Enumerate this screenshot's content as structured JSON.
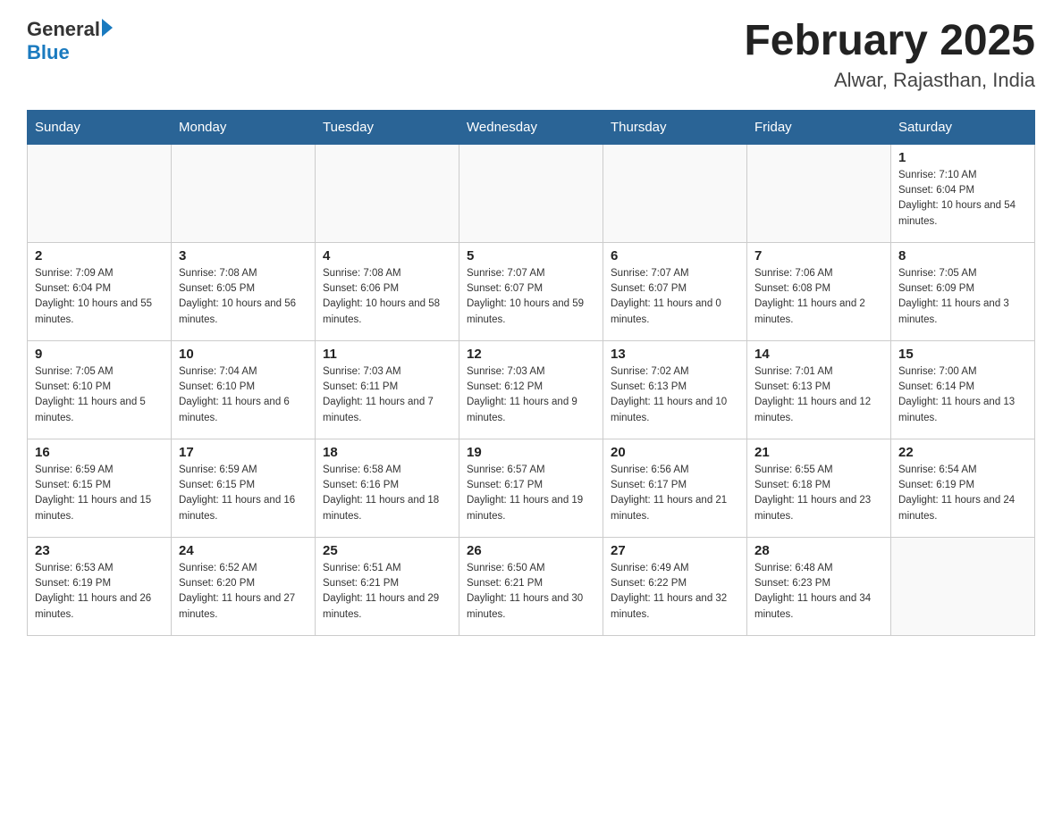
{
  "header": {
    "logo_general": "General",
    "logo_blue": "Blue",
    "month_title": "February 2025",
    "location": "Alwar, Rajasthan, India"
  },
  "weekdays": [
    "Sunday",
    "Monday",
    "Tuesday",
    "Wednesday",
    "Thursday",
    "Friday",
    "Saturday"
  ],
  "weeks": [
    [
      {
        "day": "",
        "sunrise": "",
        "sunset": "",
        "daylight": ""
      },
      {
        "day": "",
        "sunrise": "",
        "sunset": "",
        "daylight": ""
      },
      {
        "day": "",
        "sunrise": "",
        "sunset": "",
        "daylight": ""
      },
      {
        "day": "",
        "sunrise": "",
        "sunset": "",
        "daylight": ""
      },
      {
        "day": "",
        "sunrise": "",
        "sunset": "",
        "daylight": ""
      },
      {
        "day": "",
        "sunrise": "",
        "sunset": "",
        "daylight": ""
      },
      {
        "day": "1",
        "sunrise": "Sunrise: 7:10 AM",
        "sunset": "Sunset: 6:04 PM",
        "daylight": "Daylight: 10 hours and 54 minutes."
      }
    ],
    [
      {
        "day": "2",
        "sunrise": "Sunrise: 7:09 AM",
        "sunset": "Sunset: 6:04 PM",
        "daylight": "Daylight: 10 hours and 55 minutes."
      },
      {
        "day": "3",
        "sunrise": "Sunrise: 7:08 AM",
        "sunset": "Sunset: 6:05 PM",
        "daylight": "Daylight: 10 hours and 56 minutes."
      },
      {
        "day": "4",
        "sunrise": "Sunrise: 7:08 AM",
        "sunset": "Sunset: 6:06 PM",
        "daylight": "Daylight: 10 hours and 58 minutes."
      },
      {
        "day": "5",
        "sunrise": "Sunrise: 7:07 AM",
        "sunset": "Sunset: 6:07 PM",
        "daylight": "Daylight: 10 hours and 59 minutes."
      },
      {
        "day": "6",
        "sunrise": "Sunrise: 7:07 AM",
        "sunset": "Sunset: 6:07 PM",
        "daylight": "Daylight: 11 hours and 0 minutes."
      },
      {
        "day": "7",
        "sunrise": "Sunrise: 7:06 AM",
        "sunset": "Sunset: 6:08 PM",
        "daylight": "Daylight: 11 hours and 2 minutes."
      },
      {
        "day": "8",
        "sunrise": "Sunrise: 7:05 AM",
        "sunset": "Sunset: 6:09 PM",
        "daylight": "Daylight: 11 hours and 3 minutes."
      }
    ],
    [
      {
        "day": "9",
        "sunrise": "Sunrise: 7:05 AM",
        "sunset": "Sunset: 6:10 PM",
        "daylight": "Daylight: 11 hours and 5 minutes."
      },
      {
        "day": "10",
        "sunrise": "Sunrise: 7:04 AM",
        "sunset": "Sunset: 6:10 PM",
        "daylight": "Daylight: 11 hours and 6 minutes."
      },
      {
        "day": "11",
        "sunrise": "Sunrise: 7:03 AM",
        "sunset": "Sunset: 6:11 PM",
        "daylight": "Daylight: 11 hours and 7 minutes."
      },
      {
        "day": "12",
        "sunrise": "Sunrise: 7:03 AM",
        "sunset": "Sunset: 6:12 PM",
        "daylight": "Daylight: 11 hours and 9 minutes."
      },
      {
        "day": "13",
        "sunrise": "Sunrise: 7:02 AM",
        "sunset": "Sunset: 6:13 PM",
        "daylight": "Daylight: 11 hours and 10 minutes."
      },
      {
        "day": "14",
        "sunrise": "Sunrise: 7:01 AM",
        "sunset": "Sunset: 6:13 PM",
        "daylight": "Daylight: 11 hours and 12 minutes."
      },
      {
        "day": "15",
        "sunrise": "Sunrise: 7:00 AM",
        "sunset": "Sunset: 6:14 PM",
        "daylight": "Daylight: 11 hours and 13 minutes."
      }
    ],
    [
      {
        "day": "16",
        "sunrise": "Sunrise: 6:59 AM",
        "sunset": "Sunset: 6:15 PM",
        "daylight": "Daylight: 11 hours and 15 minutes."
      },
      {
        "day": "17",
        "sunrise": "Sunrise: 6:59 AM",
        "sunset": "Sunset: 6:15 PM",
        "daylight": "Daylight: 11 hours and 16 minutes."
      },
      {
        "day": "18",
        "sunrise": "Sunrise: 6:58 AM",
        "sunset": "Sunset: 6:16 PM",
        "daylight": "Daylight: 11 hours and 18 minutes."
      },
      {
        "day": "19",
        "sunrise": "Sunrise: 6:57 AM",
        "sunset": "Sunset: 6:17 PM",
        "daylight": "Daylight: 11 hours and 19 minutes."
      },
      {
        "day": "20",
        "sunrise": "Sunrise: 6:56 AM",
        "sunset": "Sunset: 6:17 PM",
        "daylight": "Daylight: 11 hours and 21 minutes."
      },
      {
        "day": "21",
        "sunrise": "Sunrise: 6:55 AM",
        "sunset": "Sunset: 6:18 PM",
        "daylight": "Daylight: 11 hours and 23 minutes."
      },
      {
        "day": "22",
        "sunrise": "Sunrise: 6:54 AM",
        "sunset": "Sunset: 6:19 PM",
        "daylight": "Daylight: 11 hours and 24 minutes."
      }
    ],
    [
      {
        "day": "23",
        "sunrise": "Sunrise: 6:53 AM",
        "sunset": "Sunset: 6:19 PM",
        "daylight": "Daylight: 11 hours and 26 minutes."
      },
      {
        "day": "24",
        "sunrise": "Sunrise: 6:52 AM",
        "sunset": "Sunset: 6:20 PM",
        "daylight": "Daylight: 11 hours and 27 minutes."
      },
      {
        "day": "25",
        "sunrise": "Sunrise: 6:51 AM",
        "sunset": "Sunset: 6:21 PM",
        "daylight": "Daylight: 11 hours and 29 minutes."
      },
      {
        "day": "26",
        "sunrise": "Sunrise: 6:50 AM",
        "sunset": "Sunset: 6:21 PM",
        "daylight": "Daylight: 11 hours and 30 minutes."
      },
      {
        "day": "27",
        "sunrise": "Sunrise: 6:49 AM",
        "sunset": "Sunset: 6:22 PM",
        "daylight": "Daylight: 11 hours and 32 minutes."
      },
      {
        "day": "28",
        "sunrise": "Sunrise: 6:48 AM",
        "sunset": "Sunset: 6:23 PM",
        "daylight": "Daylight: 11 hours and 34 minutes."
      },
      {
        "day": "",
        "sunrise": "",
        "sunset": "",
        "daylight": ""
      }
    ]
  ]
}
